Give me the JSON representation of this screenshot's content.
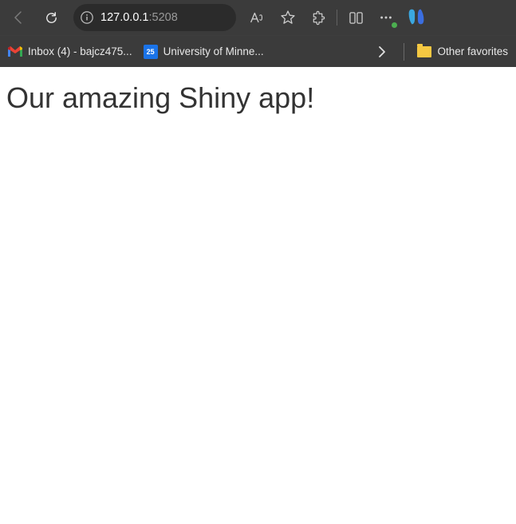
{
  "toolbar": {
    "url_host": "127.0.0.1",
    "url_port": ":5208"
  },
  "bookmarks": {
    "items": [
      {
        "label": "Inbox (4) - bajcz475...",
        "cal_day": ""
      },
      {
        "label": "University of Minne...",
        "cal_day": "25"
      }
    ],
    "other_favorites": "Other favorites"
  },
  "page": {
    "heading": "Our amazing Shiny app!"
  }
}
